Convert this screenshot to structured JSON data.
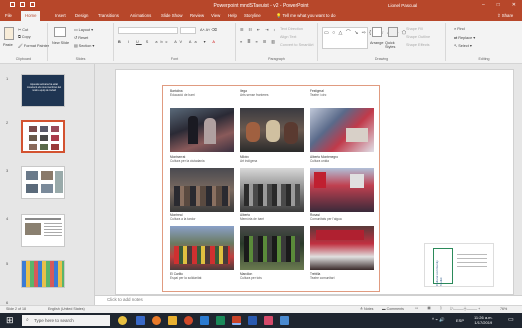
{
  "titlebar": {
    "title": "Powerpoint mndSTaeuist - v2 - PowerPoint",
    "user": "Lionel Pascual"
  },
  "menu": {
    "tabs": [
      "File",
      "Home",
      "Insert",
      "Design",
      "Transitions",
      "Animations",
      "Slide Show",
      "Review",
      "View",
      "Help",
      "Storyline"
    ],
    "tell_me": "Tell me what you want to do",
    "share": "Share"
  },
  "ribbon": {
    "clipboard": {
      "paste": "Paste",
      "cut": "Cut",
      "copy": "Copy",
      "format_painter": "Format Painter",
      "label": "Clipboard"
    },
    "slides": {
      "new_slide": "New Slide",
      "layout": "Layout",
      "reset": "Reset",
      "section": "Section",
      "label": "Slides"
    },
    "font_label": "Font",
    "paragraph": {
      "text_direction": "Text Direction",
      "align_text": "Align Text",
      "convert": "Convert to SmartArt",
      "label": "Paragraph"
    },
    "drawing": {
      "arrange": "Arrange",
      "quick_styles": "Quick Styles",
      "shape_fill": "Shape Fill",
      "shape_outline": "Shape Outline",
      "shape_effects": "Shape Effects",
      "label": "Drawing"
    },
    "editing": {
      "find": "Find",
      "replace": "Replace",
      "select": "Select",
      "label": "Editing"
    }
  },
  "thumbnails": {
    "numbers": [
      "1",
      "2",
      "3",
      "4",
      "5",
      "6"
    ],
    "slide1_text": "Aquesta setmana ha estat coneixent els nous membres del nostre equip de treball"
  },
  "slide": {
    "captions": [
      {
        "title": "Bartolina",
        "sub": "Educació de barri"
      },
      {
        "title": "Ilega",
        "sub": "Arts sense fronteres"
      },
      {
        "title": "Festigmal",
        "sub": "Teatre i circ"
      },
      {
        "title": "Montserrat",
        "sub": "Cultura per la ciutadania"
      },
      {
        "title": "Milvirc",
        "sub": "Art indígena"
      },
      {
        "title": "Alberto Montenegro",
        "sub": "Cultura unida"
      },
      {
        "title": "Montreal",
        "sub": "Cultura a la tardor"
      },
      {
        "title": "Alberto",
        "sub": "Memòria de barri"
      },
      {
        "title": "Rosasi",
        "sub": "Comunitats per l'aigua"
      },
      {
        "title": "El Carlito",
        "sub": "Espai per la solidaritat"
      },
      {
        "title": "Mandlon",
        "sub": "Cultura per tots"
      },
      {
        "title": "Trebilla",
        "sub": "Teatre comunitari"
      }
    ],
    "side_text": [
      "Cultural",
      "community",
      "Toolkit"
    ]
  },
  "notes_placeholder": "Click to add notes",
  "status": {
    "slide_of": "Slide 2 of 18",
    "language": "English (United States)",
    "notes": "Notes",
    "comments": "Comments",
    "zoom": "76%"
  },
  "taskbar": {
    "search_placeholder": "Type here to search",
    "time": "11:26 a.m.",
    "date": "1/17/2019",
    "lang": "ESP"
  }
}
